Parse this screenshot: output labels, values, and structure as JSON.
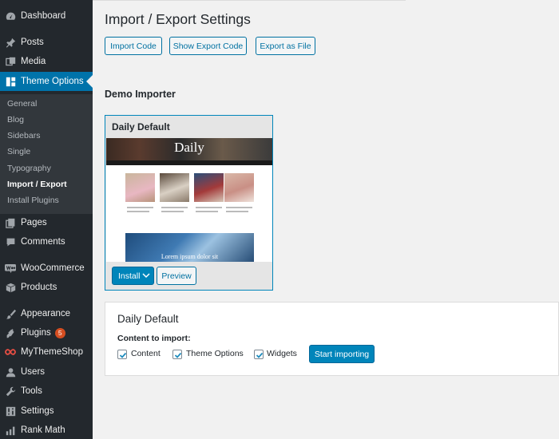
{
  "sidebar": {
    "items": [
      {
        "label": "Dashboard",
        "icon": "dashboard-icon"
      },
      {
        "label": "Posts",
        "icon": "pin-icon"
      },
      {
        "label": "Media",
        "icon": "media-icon"
      },
      {
        "label": "Theme Options",
        "icon": "grid-icon",
        "active": true
      },
      {
        "label": "Pages",
        "icon": "pages-icon"
      },
      {
        "label": "Comments",
        "icon": "comment-icon"
      },
      {
        "label": "WooCommerce",
        "icon": "woo-icon"
      },
      {
        "label": "Products",
        "icon": "box-icon"
      },
      {
        "label": "Appearance",
        "icon": "brush-icon"
      },
      {
        "label": "Plugins",
        "icon": "plug-icon",
        "badge": "5"
      },
      {
        "label": "MyThemeShop",
        "icon": "mts-icon"
      },
      {
        "label": "Users",
        "icon": "user-icon"
      },
      {
        "label": "Tools",
        "icon": "wrench-icon"
      },
      {
        "label": "Settings",
        "icon": "settings-icon"
      },
      {
        "label": "Rank Math",
        "icon": "chart-icon"
      }
    ],
    "submenu": [
      "General",
      "Blog",
      "Sidebars",
      "Single",
      "Typography",
      "Import / Export",
      "Install Plugins"
    ],
    "submenu_current": "Import / Export"
  },
  "page": {
    "title": "Import / Export Settings",
    "buttons": {
      "import_code": "Import Code",
      "show_export_code": "Show Export Code",
      "export_as_file": "Export as File"
    },
    "section_title": "Demo Importer"
  },
  "demo_card": {
    "title": "Daily Default",
    "preview_logo": "Daily",
    "preview_feature_text": "Lorem ipsum dolor sit",
    "install_label": "Install",
    "preview_label": "Preview"
  },
  "import_panel": {
    "title": "Daily Default",
    "content_label": "Content to import:",
    "options": [
      {
        "label": "Content",
        "checked": true
      },
      {
        "label": "Theme Options",
        "checked": true
      },
      {
        "label": "Widgets",
        "checked": true
      }
    ],
    "start_label": "Start importing"
  },
  "colors": {
    "sidebar_bg": "#23282d",
    "submenu_bg": "#32373c",
    "accent": "#0073aa",
    "button_primary": "#0085ba",
    "badge": "#d54e21"
  }
}
